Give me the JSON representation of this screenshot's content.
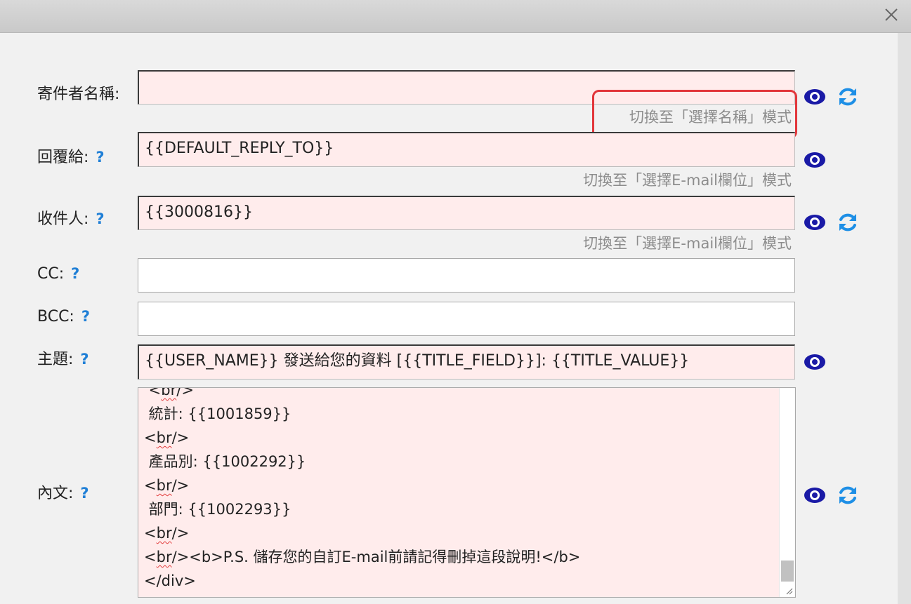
{
  "form": {
    "sender_name": {
      "label": "寄件者名稱:",
      "value": "",
      "switch_link": "切換至「選擇名稱」模式"
    },
    "reply_to": {
      "label": "回覆給:",
      "help": "?",
      "value": "{{DEFAULT_REPLY_TO}}",
      "switch_link": "切換至「選擇E-mail欄位」模式"
    },
    "recipient": {
      "label": "收件人:",
      "help": "?",
      "value": "{{3000816}}",
      "switch_link": "切換至「選擇E-mail欄位」模式"
    },
    "cc": {
      "label": "CC:",
      "help": "?",
      "value": ""
    },
    "bcc": {
      "label": "BCC:",
      "help": "?",
      "value": ""
    },
    "subject": {
      "label": "主題:",
      "help": "?",
      "value": "{{USER_NAME}} 發送給您的資料 [{{TITLE_FIELD}}]: {{TITLE_VALUE}}"
    },
    "body": {
      "label": "內文:",
      "help": "?",
      "lines": {
        "l0": {
          "pre": " <",
          "sq": "br",
          "post": "/>"
        },
        "l1": " 統計: {{1001859}}",
        "l2": {
          "pre": "<",
          "sq": "br",
          "post": "/>"
        },
        "l3": " 產品別: {{1002292}}",
        "l4": {
          "pre": "<",
          "sq": "br",
          "post": "/>"
        },
        "l5": " 部門: {{1002293}}",
        "l6": {
          "pre": "<",
          "sq": "br",
          "post": "/>"
        },
        "l7": {
          "pre": "<",
          "sq": "br",
          "post": "/><b>P.S. 儲存您的自訂E-mail前請記得刪掉這段說明!</b>"
        },
        "l8": "</div>"
      }
    }
  },
  "icons": {
    "preview": "eye-icon",
    "refresh": "refresh-icon",
    "close": "close-icon",
    "resize": "resize-grip-icon"
  },
  "colors": {
    "field_bg": "#ffecec",
    "icon_blue": "#1a1aa6",
    "refresh_blue": "#1e8fe6",
    "help_blue": "#1f7fd6",
    "highlight_red": "#e2363b"
  }
}
